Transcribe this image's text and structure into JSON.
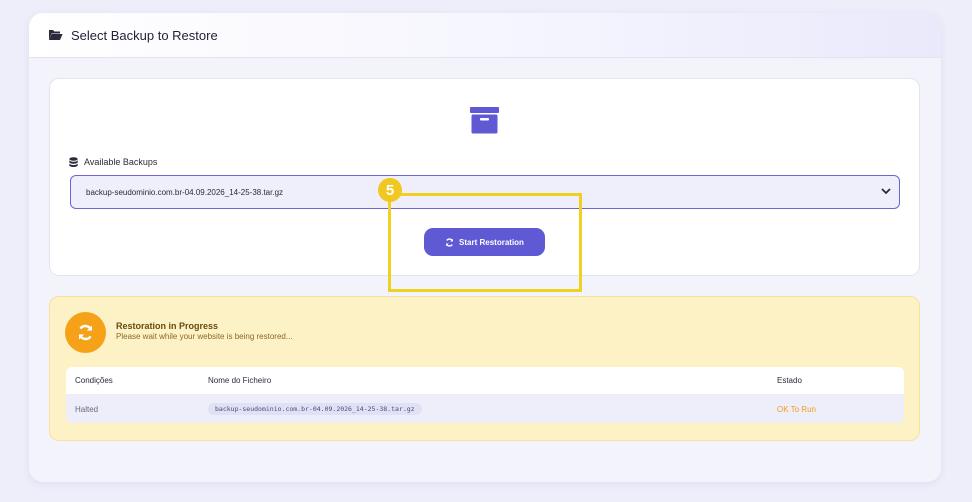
{
  "header": {
    "title": "Select Backup to Restore",
    "icon": "folder-open-icon"
  },
  "backups": {
    "label": "Available Backups",
    "label_icon": "database-icon",
    "selected": "backup-seudominio.com.br-04.09.2026_14-25-38.tar.gz",
    "archive_icon": "archive-box-icon"
  },
  "actions": {
    "start_label": "Start Restoration",
    "start_icon": "sync-icon"
  },
  "annotation": {
    "step": "5"
  },
  "progress": {
    "title": "Restoration in Progress",
    "subtitle": "Please wait while your website is being restored...",
    "icon": "sync-icon",
    "table": {
      "headers": [
        "Condições",
        "Nome do Ficheiro",
        "Estado"
      ],
      "rows": [
        {
          "condition": "Halted",
          "file": "backup-seudominio.com.br-04.09.2026_14-25-38.tar.gz",
          "status": "OK To Run"
        }
      ]
    }
  },
  "colors": {
    "accent": "#5f5ad3",
    "warning_bg": "#fdf2c5",
    "warning_icon": "#f5a219",
    "status_ok": "#f39a1a",
    "highlight": "#f0d020"
  }
}
